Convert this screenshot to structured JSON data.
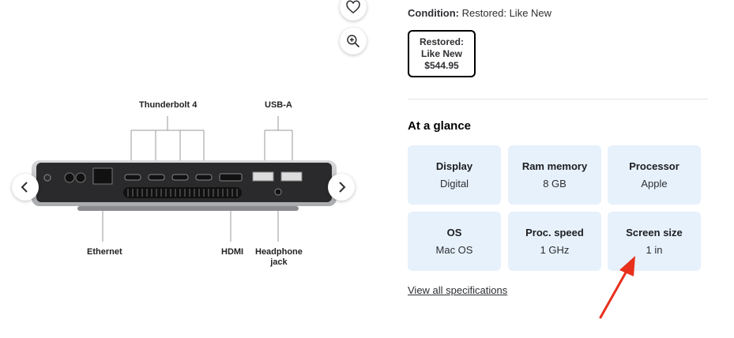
{
  "colors": {
    "tile_bg": "#e6f1fc",
    "arrow": "#e8301c",
    "text": "#2e2f32"
  },
  "gallery": {
    "icons": [
      "heart-icon",
      "zoom-in-icon",
      "chevron-left-icon",
      "chevron-right-icon"
    ],
    "port_labels": {
      "thunderbolt": "Thunderbolt 4",
      "usba": "USB-A",
      "ethernet": "Ethernet",
      "hdmi": "HDMI",
      "headphone": "Headphone\njack"
    }
  },
  "details": {
    "condition_label": "Condition:",
    "condition_value": "Restored: Like New",
    "option": {
      "line1": "Restored:",
      "line2": "Like New",
      "price": "$544.95"
    },
    "at_a_glance": "At a glance",
    "specs": [
      {
        "title": "Display",
        "value": "Digital"
      },
      {
        "title": "Ram memory",
        "value": "8 GB"
      },
      {
        "title": "Processor",
        "value": "Apple"
      },
      {
        "title": "OS",
        "value": "Mac OS"
      },
      {
        "title": "Proc. speed",
        "value": "1 GHz"
      },
      {
        "title": "Screen size",
        "value": "1 in"
      }
    ],
    "view_all": "View all specifications"
  }
}
